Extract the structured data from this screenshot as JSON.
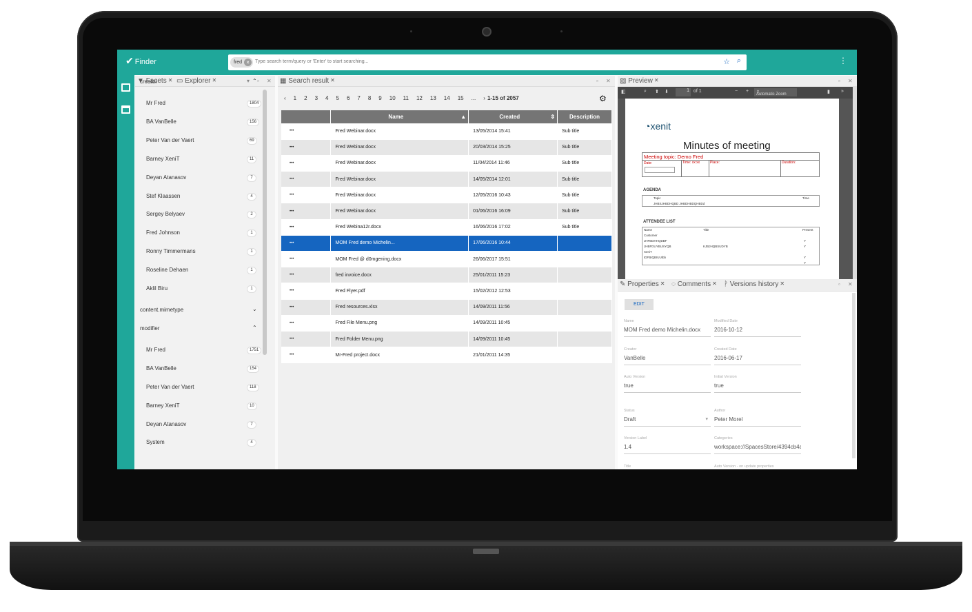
{
  "app": {
    "name": "Finder"
  },
  "search": {
    "chip": "fred",
    "placeholder": "Type search term/query or 'Enter' to start searching..."
  },
  "facets": {
    "tab_facets": "Facets",
    "tab_explorer": "Explorer",
    "groups": [
      {
        "label": "creator",
        "items": [
          {
            "label": "Mr Fred",
            "count": "1804"
          },
          {
            "label": "BA VanBelle",
            "count": "156"
          },
          {
            "label": "Peter Van der Vaert",
            "count": "69"
          },
          {
            "label": "Barney XeniT",
            "count": "11"
          },
          {
            "label": "Deyan Atanasov",
            "count": "7"
          },
          {
            "label": "Stef Klaassen",
            "count": "4"
          },
          {
            "label": "Sergey Belyaev",
            "count": "2"
          },
          {
            "label": "Fred Johnson",
            "count": "1"
          },
          {
            "label": "Ronny Timmermans",
            "count": "1"
          },
          {
            "label": "Roseline Dehaen",
            "count": "1"
          },
          {
            "label": "Aklil Biru",
            "count": "1"
          }
        ]
      },
      {
        "label": "content.mimetype",
        "items": []
      },
      {
        "label": "modifier",
        "items": [
          {
            "label": "Mr Fred",
            "count": "1751"
          },
          {
            "label": "BA VanBelle",
            "count": "154"
          },
          {
            "label": "Peter Van der Vaert",
            "count": "118"
          },
          {
            "label": "Barney XeniT",
            "count": "10"
          },
          {
            "label": "Deyan Atanasov",
            "count": "7"
          },
          {
            "label": "System",
            "count": "4"
          }
        ]
      }
    ]
  },
  "results": {
    "tab": "Search result",
    "pages": [
      "1",
      "2",
      "3",
      "4",
      "5",
      "6",
      "7",
      "8",
      "9",
      "10",
      "11",
      "12",
      "13",
      "14",
      "15",
      "..."
    ],
    "range": "1-15 of 2057",
    "columns": {
      "name": "Name",
      "created": "Created",
      "description": "Description"
    },
    "rows": [
      {
        "name": "Fred Webinar.docx",
        "created": "13/05/2014 15:41",
        "description": "Sub title"
      },
      {
        "name": "Fred Webinar.docx",
        "created": "20/03/2014 15:25",
        "description": "Sub title"
      },
      {
        "name": "Fred Webinar.docx",
        "created": "11/04/2014 11:46",
        "description": "Sub title"
      },
      {
        "name": "Fred Webinar.docx",
        "created": "14/05/2014 12:01",
        "description": "Sub title"
      },
      {
        "name": "Fred Webinar.docx",
        "created": "12/05/2016 10:43",
        "description": "Sub title"
      },
      {
        "name": "Fred Webinar.docx",
        "created": "01/06/2016 16:09",
        "description": "Sub title"
      },
      {
        "name": "Fred Webina12r.docx",
        "created": "16/06/2016 17:02",
        "description": "Sub title"
      },
      {
        "name": "MOM Fred demo Michelin...",
        "created": "17/06/2016 10:44",
        "description": "",
        "selected": true
      },
      {
        "name": "MOM Fred @ d0mgening.docx",
        "created": "26/06/2017 15:51",
        "description": ""
      },
      {
        "name": "fred invoice.docx",
        "created": "25/01/2011 15:23",
        "description": ""
      },
      {
        "name": "Fred Flyer.pdf",
        "created": "15/02/2012 12:53",
        "description": ""
      },
      {
        "name": "Fred resources.xlsx",
        "created": "14/09/2011 11:56",
        "description": ""
      },
      {
        "name": "Fred File Menu.png",
        "created": "14/09/2011 10:45",
        "description": ""
      },
      {
        "name": "Fred Folder Menu.png",
        "created": "14/09/2011 10:45",
        "description": ""
      },
      {
        "name": "Mr-Fred project.docx",
        "created": "21/01/2011 14:35",
        "description": ""
      }
    ]
  },
  "preview": {
    "tab": "Preview",
    "page": "1",
    "of": "of 1",
    "zoom": "Automatic Zoom",
    "doc": {
      "logo": "xenit",
      "title": "Minutes of meeting",
      "topic": "Meeting topic: Demo Fred",
      "date": "Date:",
      "time": "Time: xx:xx",
      "place": "Place:",
      "duration": "Duration:",
      "agenda": "AGENDA",
      "topic_col": "Topic",
      "time_col": "Time",
      "agenda_row": "JHBSJHBDHQBD JHBDHBDQHBDd",
      "attendee": "ATTENDEE LIST",
      "name_col": "Name",
      "title_col": "Title",
      "present_col": "Present",
      "customer": "Customer",
      "a1": "JHFBDHHQDBF",
      "a2": "JHBFDUYBUSYQB",
      "a2t": "KJBJHQBSUDYB",
      "xenit": "XeniT",
      "a3": "IDFBIQBIUUIbb",
      "y": "Y"
    }
  },
  "properties": {
    "tab_props": "Properties",
    "tab_comments": "Comments",
    "tab_versions": "Versions history",
    "edit": "EDIT",
    "fields": [
      {
        "label": "Name",
        "value": "MOM Fred demo Michelin.docx"
      },
      {
        "label": "Modified Date",
        "value": "2016-10-12"
      },
      {
        "label": "Creator",
        "value": "VanBelle"
      },
      {
        "label": "Created Date",
        "value": "2016-06-17"
      },
      {
        "label": "Auto Version",
        "value": "true"
      },
      {
        "label": "Initial Version",
        "value": "true"
      },
      {
        "label": "Status",
        "value": "Draft"
      },
      {
        "label": "Author",
        "value": "Peter Morel"
      },
      {
        "label": "Version Label",
        "value": "1.4"
      },
      {
        "label": "Categories",
        "value": "workspace://SpacesStore/4394cb4a"
      },
      {
        "label": "Title",
        "value": ""
      },
      {
        "label": "Auto Version - on update properties",
        "value": ""
      }
    ]
  }
}
